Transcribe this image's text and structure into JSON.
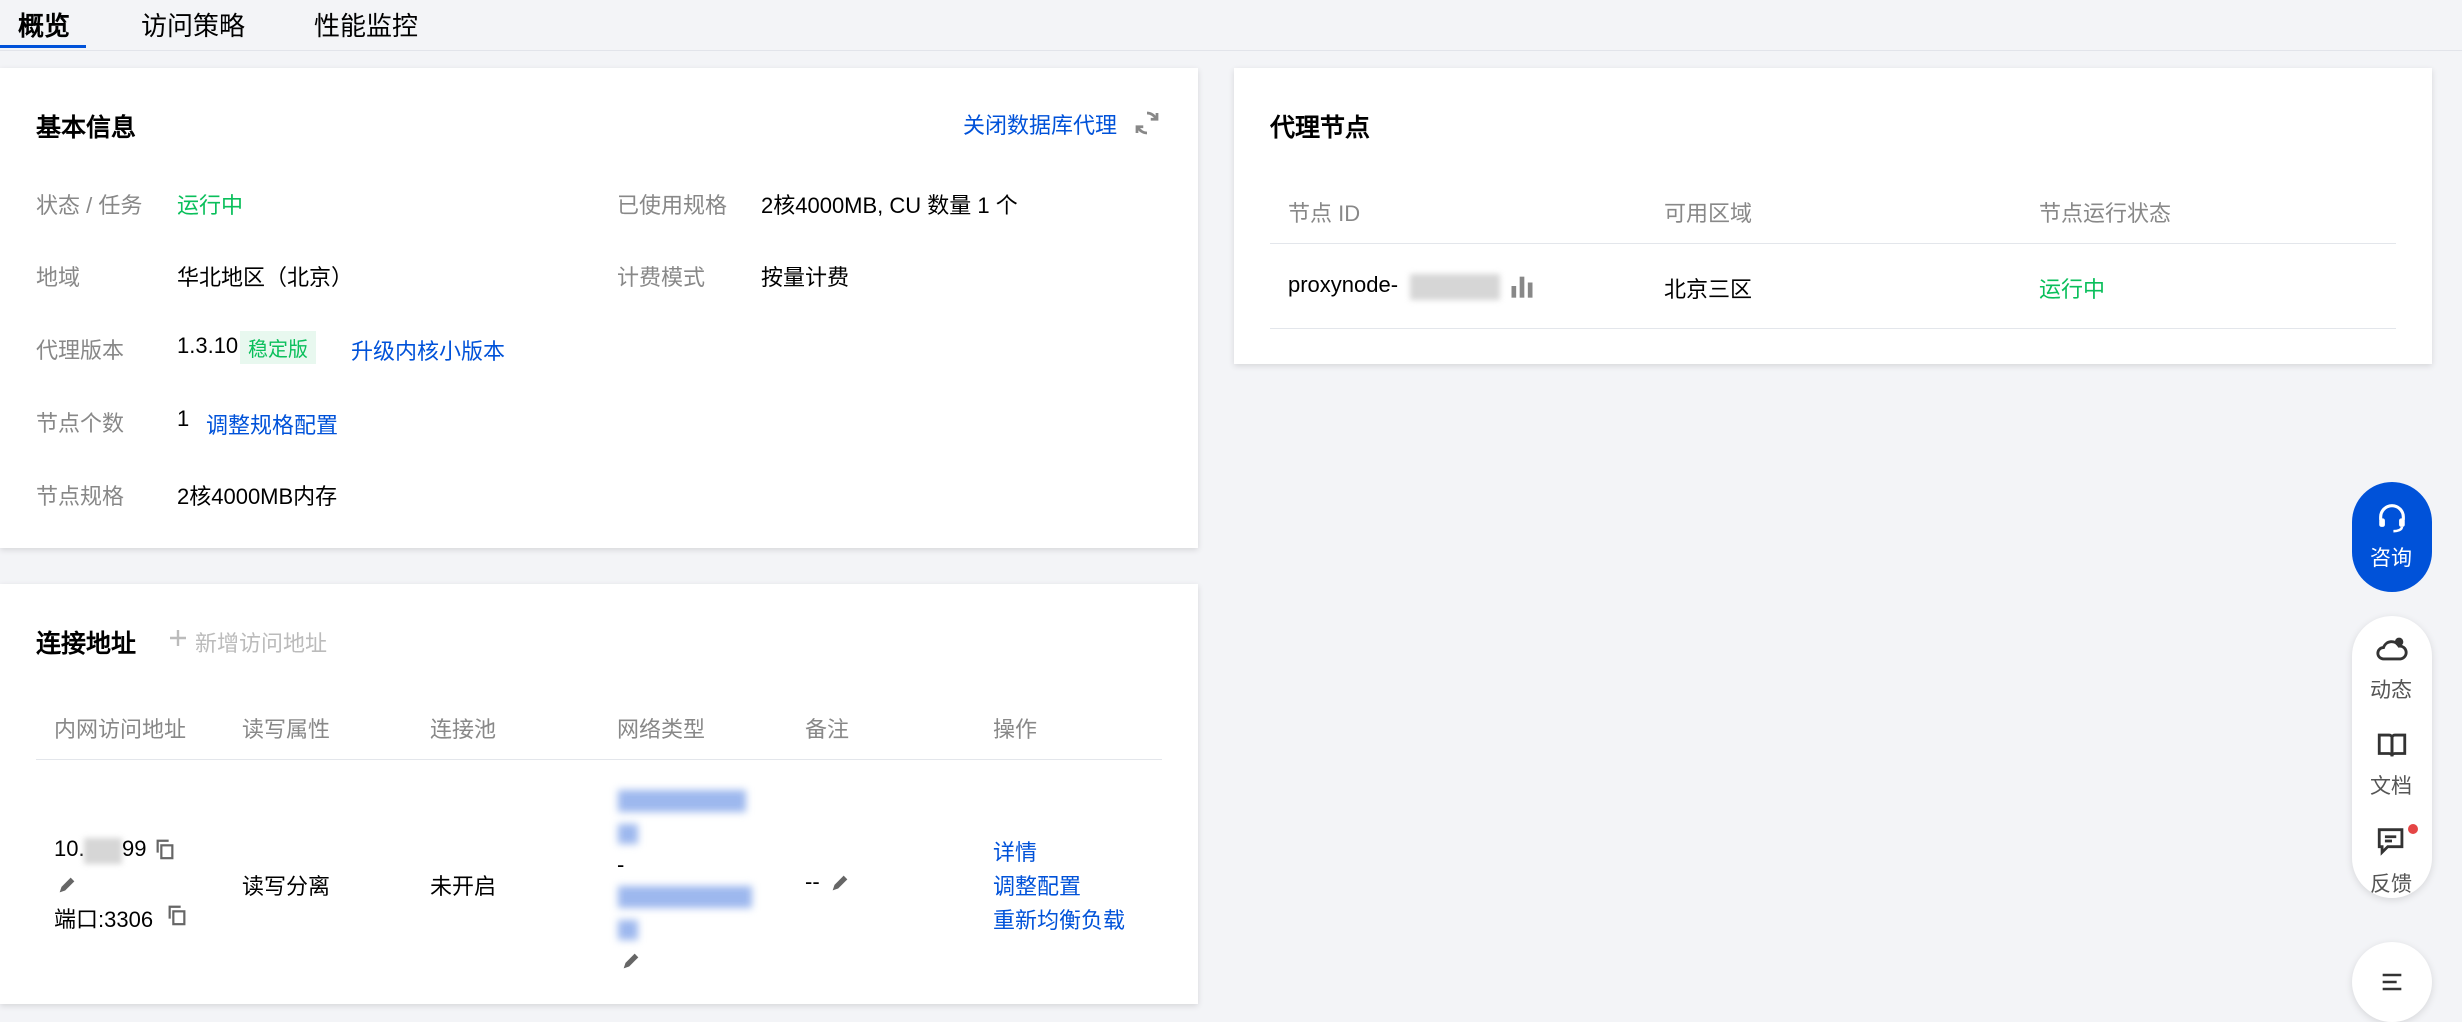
{
  "tabs": [
    "概览",
    "访问策略",
    "性能监控"
  ],
  "basic_info": {
    "title": "基本信息",
    "close_proxy_label": "关闭数据库代理",
    "status_label": "状态 / 任务",
    "status_value": "运行中",
    "region_label": "地域",
    "region_value": "华北地区（北京）",
    "version_label": "代理版本",
    "version_value": "1.3.10",
    "version_tag": "稳定版",
    "upgrade_label": "升级内核小版本",
    "node_count_label": "节点个数",
    "node_count_value": "1",
    "adjust_spec_label": "调整规格配置",
    "node_spec_label": "节点规格",
    "node_spec_value": "2核4000MB内存",
    "used_spec_label": "已使用规格",
    "used_spec_value": "2核4000MB, CU 数量 1 个",
    "billing_label": "计费模式",
    "billing_value": "按量计费"
  },
  "proxy_nodes": {
    "title": "代理节点",
    "columns": [
      "节点 ID",
      "可用区域",
      "节点运行状态"
    ],
    "rows": [
      {
        "node_id": "proxynode-",
        "zone": "北京三区",
        "status": "运行中"
      }
    ]
  },
  "connections": {
    "title": "连接地址",
    "add_label": "新增访问地址",
    "columns": [
      "内网访问地址",
      "读写属性",
      "连接池",
      "网络类型",
      "备注",
      "操作"
    ],
    "rows": [
      {
        "address_prefix": "10.",
        "address_suffix": "99",
        "port": "端口:3306",
        "rw": "读写分离",
        "pool": "未开启",
        "network_sep": "-",
        "remark": "--",
        "actions": [
          "详情",
          "调整配置",
          "重新均衡负载"
        ]
      }
    ]
  },
  "float_panel": {
    "consult": "咨询",
    "items": [
      "动态",
      "文档",
      "反馈"
    ]
  },
  "colors": {
    "accent": "#0052d9",
    "success": "#0abf5b",
    "background": "#f3f4f7"
  }
}
